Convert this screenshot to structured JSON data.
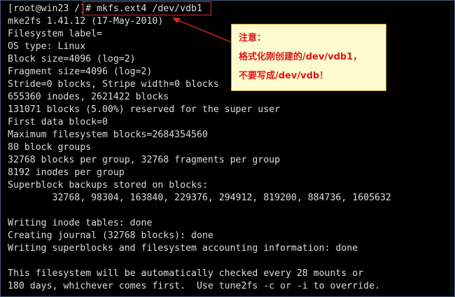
{
  "terminal": {
    "lines": [
      "[root@win23 /]# mkfs.ext4 /dev/vdb1",
      "mke2fs 1.41.12 (17-May-2010)",
      "Filesystem label=",
      "OS type: Linux",
      "Block size=4096 (log=2)",
      "Fragment size=4096 (log=2)",
      "Stride=0 blocks, Stripe width=0 blocks",
      "655360 inodes, 2621422 blocks",
      "131071 blocks (5.00%) reserved for the super user",
      "First data block=0",
      "Maximum filesystem blocks=2684354560",
      "80 block groups",
      "32768 blocks per group, 32768 fragments per group",
      "8192 inodes per group",
      "Superblock backups stored on blocks:",
      "        32768, 98304, 163840, 229376, 294912, 819200, 884736, 1605632",
      "",
      "Writing inode tables: done",
      "Creating journal (32768 blocks): done",
      "Writing superblocks and filesystem accounting information: done",
      "",
      "This filesystem will be automatically checked every 28 mounts or",
      "180 days, whichever comes first.  Use tune2fs -c or -i to override."
    ]
  },
  "annotation": {
    "title": "注意：",
    "line1": "格式化刚创建的/dev/vdb1，",
    "line2": "不要写成/dev/vdb！"
  },
  "colors": {
    "terminal_background": "#000000",
    "terminal_text": "#dcdcdc",
    "highlight_border": "#e0281f",
    "note_background": "#fefccf",
    "note_border": "#d4a533",
    "note_text": "#e0141e"
  }
}
